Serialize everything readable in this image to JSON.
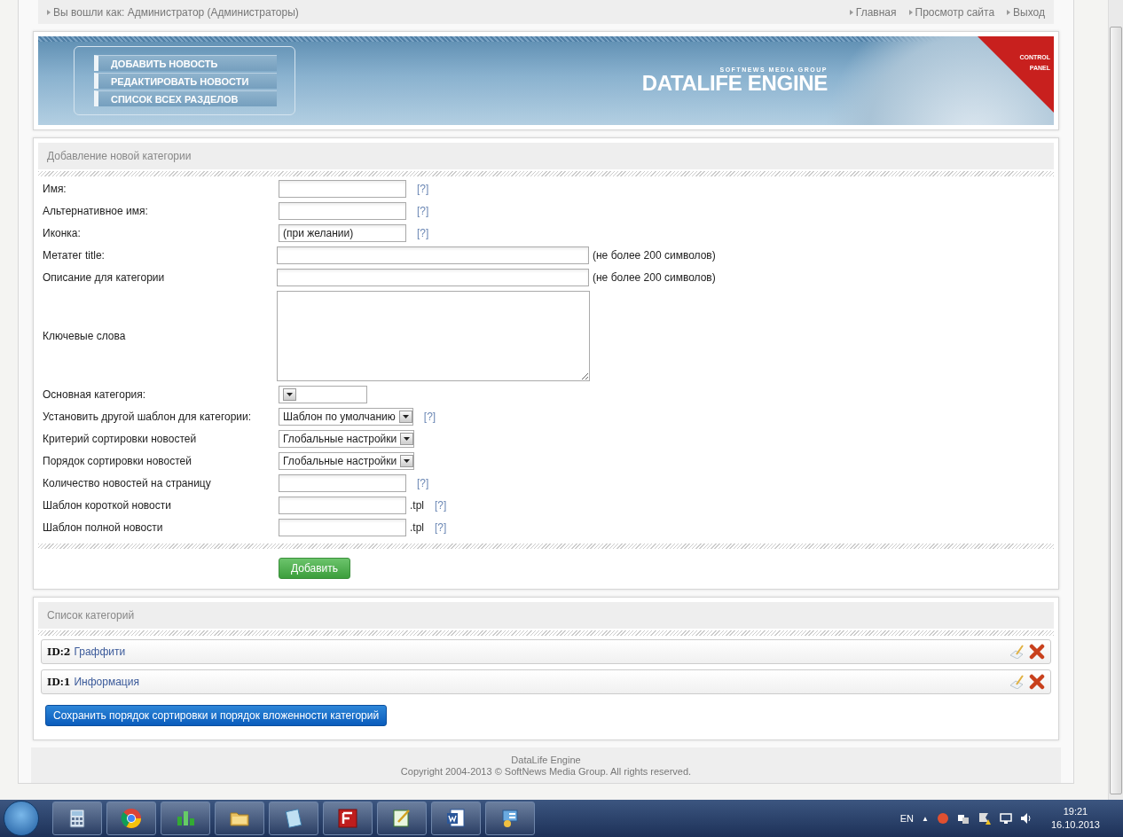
{
  "top_bar": {
    "logged_in": "Вы вошли как: Администратор (Администраторы)",
    "links": [
      "Главная",
      "Просмотр сайта",
      "Выход"
    ]
  },
  "header": {
    "menu": [
      "ДОБАВИТЬ НОВОСТЬ",
      "РЕДАКТИРОВАТЬ НОВОСТИ",
      "СПИСОК ВСЕХ РАЗДЕЛОВ"
    ],
    "tagline": "SOFTNEWS MEDIA GROUP",
    "brand": "DATALIFE ENGINE",
    "corner": [
      "CONTROL",
      "PANEL"
    ]
  },
  "form": {
    "title": "Добавление новой категории",
    "fields": [
      {
        "kind": "text",
        "label": "Имя:",
        "help": "[?]"
      },
      {
        "kind": "text",
        "label": "Альтернативное имя:",
        "help": "[?]"
      },
      {
        "kind": "text",
        "label": "Иконка:",
        "value": "(при желании)",
        "help": "[?]"
      },
      {
        "kind": "wide",
        "label": "Метатег title:",
        "note": "(не более 200 символов)"
      },
      {
        "kind": "wide",
        "label": "Описание для категории",
        "note": "(не более 200 символов)"
      },
      {
        "kind": "textarea",
        "label": "Ключевые слова"
      },
      {
        "kind": "select",
        "label": "Основная категория:"
      },
      {
        "kind": "select",
        "label": "Установить другой шаблон для категории:",
        "value": "Шаблон по умолчанию",
        "help": "[?]"
      },
      {
        "kind": "select",
        "label": "Критерий сортировки новостей",
        "value": "Глобальные настройки"
      },
      {
        "kind": "select",
        "label": "Порядок сортировки новостей",
        "value": "Глобальные настройки"
      },
      {
        "kind": "text",
        "label": "Количество новостей на страницу",
        "help": "[?]"
      },
      {
        "kind": "text",
        "label": "Шаблон короткой новости",
        "suffix": ".tpl",
        "help": "[?]"
      },
      {
        "kind": "text",
        "label": "Шаблон полной новости",
        "suffix": ".tpl",
        "help": "[?]"
      }
    ],
    "submit": "Добавить"
  },
  "categories": {
    "title": "Список категорий",
    "items": [
      {
        "id": "ID:2",
        "name": "Граффити"
      },
      {
        "id": "ID:1",
        "name": "Информация"
      }
    ],
    "save_button": "Сохранить порядок сортировки и порядок вложенности категорий"
  },
  "footer": [
    "DataLife Engine",
    "Copyright 2004-2013 © SoftNews Media Group. All rights reserved."
  ],
  "taskbar": {
    "language": "EN",
    "tray_arrow": "▲",
    "time": "19:21",
    "date": "16.10.2013"
  }
}
